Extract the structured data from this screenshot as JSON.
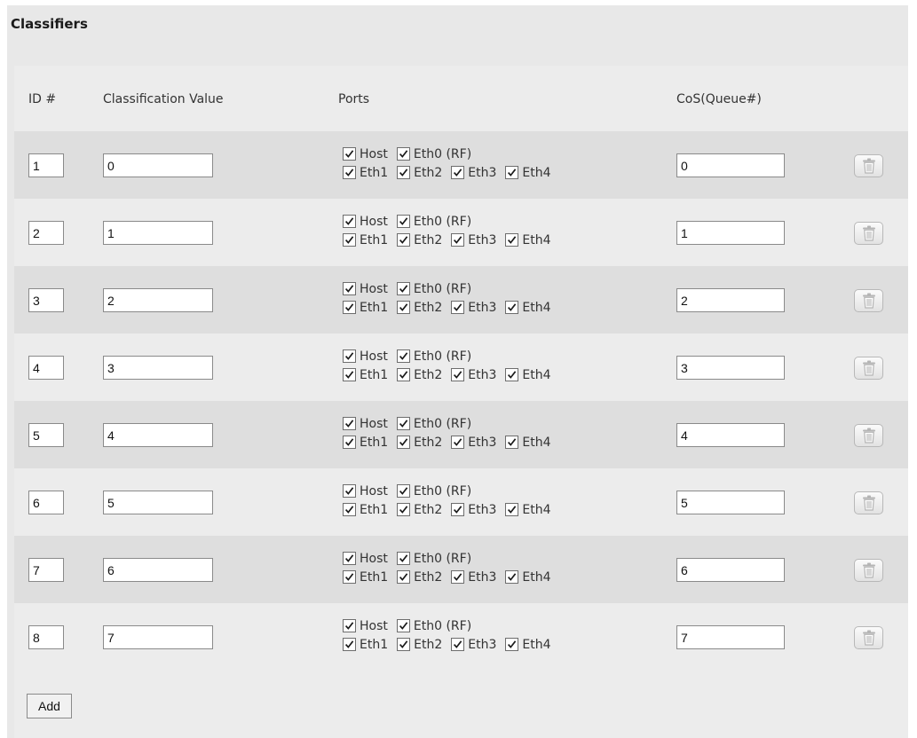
{
  "panel": {
    "title": "Classifiers"
  },
  "table": {
    "headers": {
      "id": "ID #",
      "classification_value": "Classification Value",
      "ports": "Ports",
      "cos": "CoS(Queue#)"
    },
    "port_labels": {
      "line1": [
        "Host",
        "Eth0 (RF)"
      ],
      "line2": [
        "Eth1",
        "Eth2",
        "Eth3",
        "Eth4"
      ]
    },
    "rows": [
      {
        "id": "1",
        "classification_value": "0",
        "cos": "0",
        "ports_checked": [
          true,
          true,
          true,
          true,
          true,
          true
        ]
      },
      {
        "id": "2",
        "classification_value": "1",
        "cos": "1",
        "ports_checked": [
          true,
          true,
          true,
          true,
          true,
          true
        ]
      },
      {
        "id": "3",
        "classification_value": "2",
        "cos": "2",
        "ports_checked": [
          true,
          true,
          true,
          true,
          true,
          true
        ]
      },
      {
        "id": "4",
        "classification_value": "3",
        "cos": "3",
        "ports_checked": [
          true,
          true,
          true,
          true,
          true,
          true
        ]
      },
      {
        "id": "5",
        "classification_value": "4",
        "cos": "4",
        "ports_checked": [
          true,
          true,
          true,
          true,
          true,
          true
        ]
      },
      {
        "id": "6",
        "classification_value": "5",
        "cos": "5",
        "ports_checked": [
          true,
          true,
          true,
          true,
          true,
          true
        ]
      },
      {
        "id": "7",
        "classification_value": "6",
        "cos": "6",
        "ports_checked": [
          true,
          true,
          true,
          true,
          true,
          true
        ]
      },
      {
        "id": "8",
        "classification_value": "7",
        "cos": "7",
        "ports_checked": [
          true,
          true,
          true,
          true,
          true,
          true
        ]
      }
    ],
    "delete_icon": "trash-icon"
  },
  "footer": {
    "add_label": "Add"
  }
}
